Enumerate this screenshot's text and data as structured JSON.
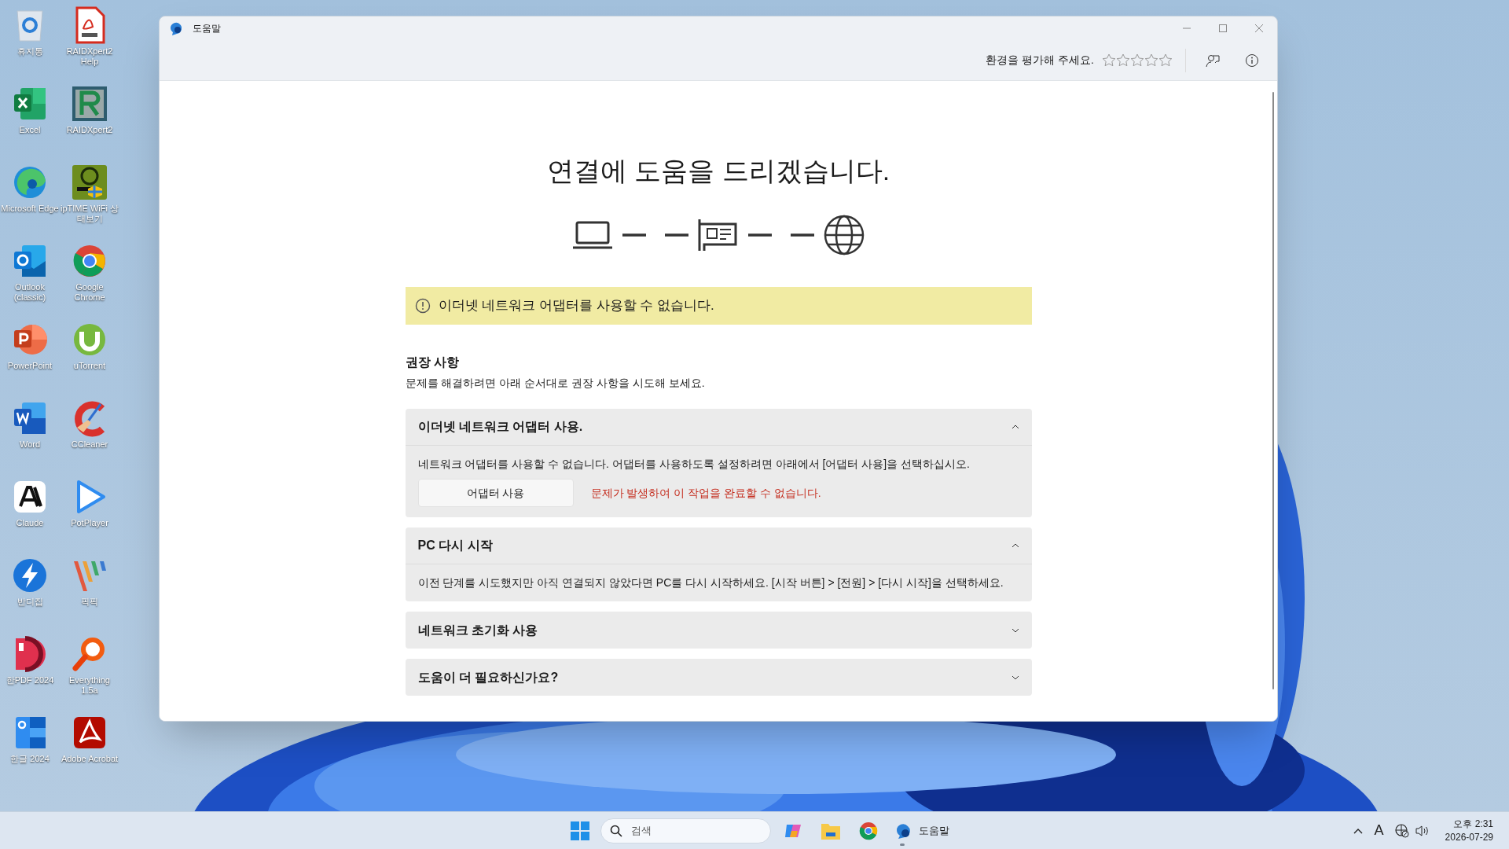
{
  "desktop_icons": [
    {
      "label": "휴지통",
      "kind": "bin"
    },
    {
      "label": "RAIDXpert2 Help",
      "kind": "pdf"
    },
    {
      "label": "Excel",
      "kind": "excel"
    },
    {
      "label": "RAIDXpert2",
      "kind": "raid"
    },
    {
      "label": "Microsoft Edge",
      "kind": "edge"
    },
    {
      "label": "ipTIME WiFi 상태보기",
      "kind": "wifi"
    },
    {
      "label": "Outlook (classic)",
      "kind": "outlook"
    },
    {
      "label": "Google Chrome",
      "kind": "chrome"
    },
    {
      "label": "PowerPoint",
      "kind": "powerpoint"
    },
    {
      "label": "uTorrent",
      "kind": "torrent"
    },
    {
      "label": "Word",
      "kind": "word"
    },
    {
      "label": "CCleaner",
      "kind": "cleaner"
    },
    {
      "label": "Claude",
      "kind": "claude"
    },
    {
      "label": "PotPlayer",
      "kind": "player"
    },
    {
      "label": "반디집",
      "kind": "bolt"
    },
    {
      "label": "픽픽",
      "kind": "stripes"
    },
    {
      "label": "한PDF 2024",
      "kind": "hanpdf"
    },
    {
      "label": "Everything 1.5a",
      "kind": "magnifier"
    },
    {
      "label": "한글 2024",
      "kind": "hangul"
    },
    {
      "label": "Adobe Acrobat",
      "kind": "acrobat"
    }
  ],
  "window": {
    "title": "도움말",
    "rating_prompt": "환경을 평가해 주세요.",
    "stars": 0
  },
  "content": {
    "heading": "연결에 도움을 드리겠습니다.",
    "alert": "이더넷 네트워크 어댑터를 사용할 수 없습니다.",
    "section_title": "권장 사항",
    "section_subtitle": "문제를 해결하려면 아래 순서대로 권장 사항을 시도해 보세요.",
    "accordions": [
      {
        "title": "이더넷 네트워크 어댑터 사용.",
        "expanded": true,
        "body": "네트워크 어댑터를 사용할 수 없습니다. 어댑터를 사용하도록 설정하려면 아래에서 [어댑터 사용]을 선택하십시오.",
        "button": "어댑터 사용",
        "error": "문제가 발생하여 이 작업을 완료할 수 없습니다."
      },
      {
        "title": "PC 다시 시작",
        "expanded": true,
        "body": "이전 단계를 시도했지만 아직 연결되지 않았다면 PC를 다시 시작하세요. [시작 버튼] > [전원] > [다시 시작]을 선택하세요."
      },
      {
        "title": "네트워크 초기화 사용",
        "expanded": false
      },
      {
        "title": "도움이 더 필요하신가요?",
        "expanded": false
      }
    ]
  },
  "taskbar": {
    "search_placeholder": "검색",
    "active_app": "도움말",
    "input_indicator": "A",
    "time": "오후 2:31",
    "date": "2026-07-29"
  }
}
